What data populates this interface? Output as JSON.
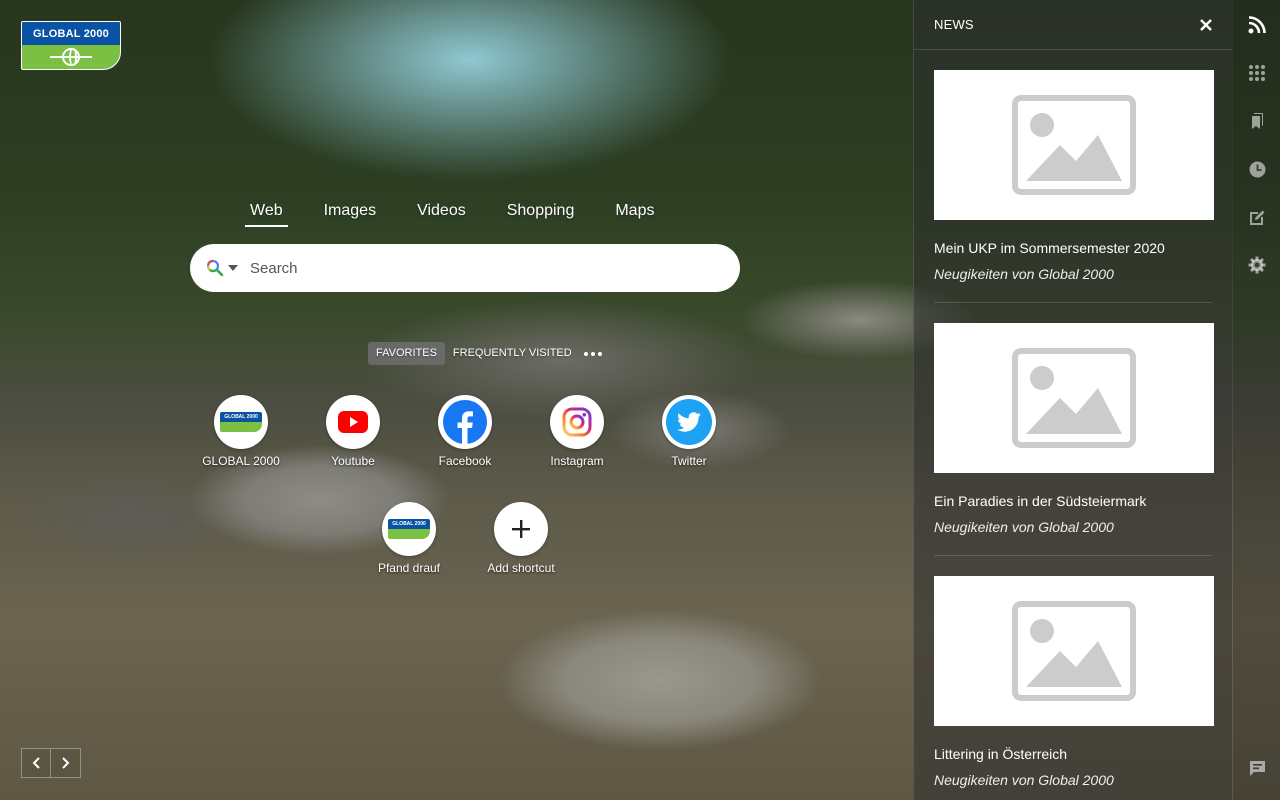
{
  "logo": {
    "text": "GLOBAL 2000"
  },
  "search": {
    "tabs": [
      {
        "label": "Web",
        "active": true
      },
      {
        "label": "Images",
        "active": false
      },
      {
        "label": "Videos",
        "active": false
      },
      {
        "label": "Shopping",
        "active": false
      },
      {
        "label": "Maps",
        "active": false
      }
    ],
    "placeholder": "Search"
  },
  "shortcut_tabs": {
    "favorites": "FAVORITES",
    "frequently_visited": "FREQUENTLY VISITED"
  },
  "shortcuts": [
    {
      "label": "GLOBAL 2000",
      "icon": "global2000-logo"
    },
    {
      "label": "Youtube",
      "icon": "youtube-icon"
    },
    {
      "label": "Facebook",
      "icon": "facebook-icon"
    },
    {
      "label": "Instagram",
      "icon": "instagram-icon"
    },
    {
      "label": "Twitter",
      "icon": "twitter-icon"
    },
    {
      "label": "Pfand drauf",
      "icon": "global2000-logo"
    },
    {
      "label": "Add shortcut",
      "icon": "plus-icon"
    }
  ],
  "news": {
    "title": "NEWS",
    "items": [
      {
        "headline": "Mein UKP im Sommersemester 2020",
        "source": "Neugikeiten von Global 2000"
      },
      {
        "headline": "Ein Paradies in der Südsteiermark",
        "source": "Neugikeiten von Global 2000"
      },
      {
        "headline": "Littering in Österreich",
        "source": "Neugikeiten von Global 2000"
      }
    ]
  },
  "colors": {
    "brand_blue": "#0a52a3",
    "brand_green": "#7bc043",
    "youtube_red": "#ff0000",
    "facebook_blue": "#1877f2",
    "twitter_blue": "#1da1f2"
  }
}
